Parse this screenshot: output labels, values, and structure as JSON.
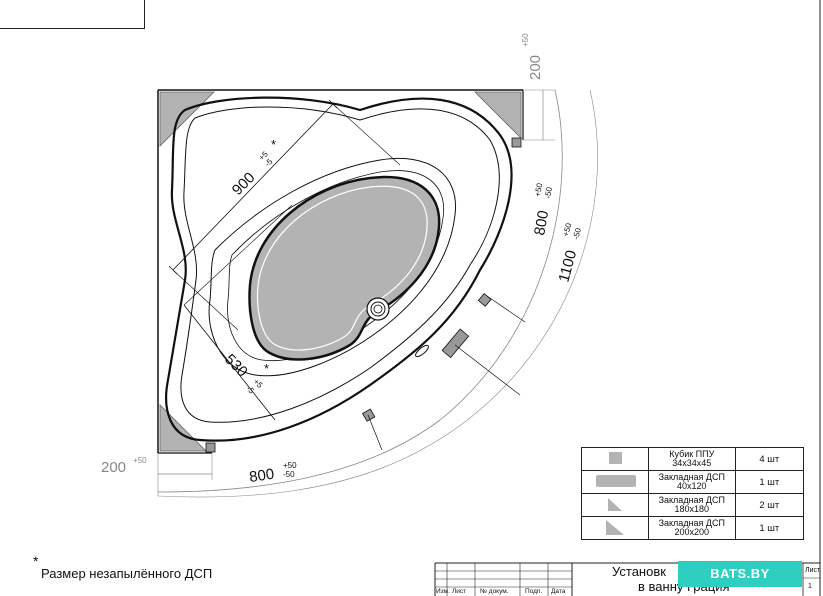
{
  "drawing": {
    "dimensions": {
      "diag_900": "900",
      "diag_900_tol_plus": "+5",
      "diag_900_tol_minus": "-5",
      "diag_900_star": "*",
      "diag_530": "530",
      "diag_530_tol_plus": "+5",
      "diag_530_tol_minus": "-5",
      "diag_530_star": "*",
      "top_200": "200",
      "top_200_tol": "+50",
      "left_200": "200",
      "left_200_tol": "+50",
      "right_800": "800",
      "right_800_tol_plus": "+50",
      "right_800_tol_minus": "-50",
      "right_1100": "1100",
      "right_1100_tol_plus": "+50",
      "right_1100_tol_minus": "-50",
      "bottom_800": "800",
      "bottom_800_tol_plus": "+50",
      "bottom_800_tol_minus": "-50"
    }
  },
  "legend": {
    "rows": [
      {
        "name": "Кубик ППУ 34х34х45",
        "name_l1": "Кубик ППУ",
        "name_l2": "34х34х45",
        "qty": "4 шт",
        "swatch": "small-square"
      },
      {
        "name_l1": "Закладная ДСП",
        "name_l2": "40х120",
        "qty": "1 шт",
        "swatch": "bar"
      },
      {
        "name_l1": "Закладная ДСП",
        "name_l2": "180х180",
        "qty": "2 шт",
        "swatch": "triangle-small"
      },
      {
        "name_l1": "Закладная ДСП",
        "name_l2": "200х200",
        "qty": "1 шт",
        "swatch": "triangle-large"
      }
    ]
  },
  "footnote": {
    "star": "*",
    "text": "Размер незапылённого ДСП"
  },
  "stamp": {
    "title_line1": "Установк",
    "title_line2": "в ванну Грация",
    "brand": "BATS.BY",
    "sheet_label": "Лист",
    "sheet_number": "1",
    "columns": [
      "Изм.",
      "Лист",
      "№ докум.",
      "Подп.",
      "Дата"
    ]
  },
  "colors": {
    "brand": "#2ecfc0",
    "fill_grey": "#b3b3b3",
    "line": "#111111"
  }
}
